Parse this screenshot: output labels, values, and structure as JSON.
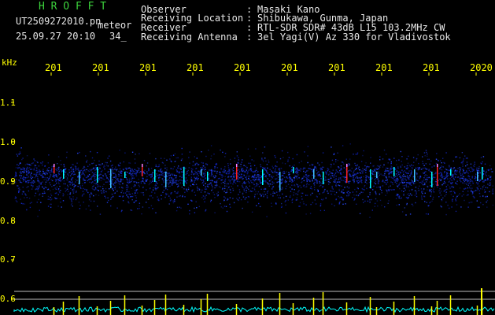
{
  "header": {
    "station": "H R O F F T",
    "file_name": "UT2509272010.pn",
    "mode": "meteor",
    "datetime": "25.09.27 20:10",
    "count": "34_",
    "info_labels": [
      "Observer",
      "Receiving Location",
      "Receiver",
      "Receiving Antenna"
    ],
    "info_separator": ":",
    "info_values": [
      "Masaki Kano",
      "Shibukawa, Gunma, Japan",
      "RTL-SDR SDR# 43dB L15 103.2MHz CW",
      "3el Yagi(V) Az 330 for Vladivostok"
    ]
  },
  "axis": {
    "unit": "kHz",
    "y_ticks": [
      "1.1",
      "1.0",
      "0.9",
      "0.8",
      "0.7",
      "0.6"
    ],
    "x_ticks": [
      "201",
      "201",
      "201",
      "201",
      "201",
      "201",
      "201",
      "201",
      "201",
      "2020"
    ]
  },
  "colors": {
    "header_text": "#e8e8e8",
    "station": "#3cd23c",
    "ticks": "#ffff00",
    "noise_blue": "#1a2fd0",
    "signal_cyan": "#00ffff",
    "echo_red": "#ff2020",
    "power_yellow": "#ffff00"
  }
}
